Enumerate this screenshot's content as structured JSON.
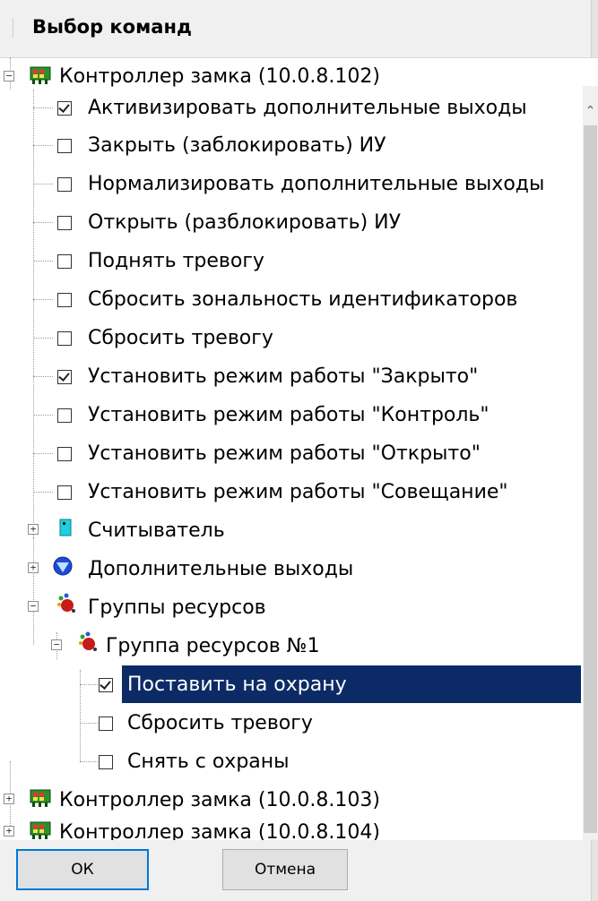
{
  "header": {
    "title": "Выбор команд"
  },
  "tree": {
    "items": [
      {
        "label": "Контроллер замка (10.0.8.102)"
      },
      {
        "label": "Активизировать дополнительные выходы",
        "checked": true
      },
      {
        "label": "Закрыть (заблокировать) ИУ",
        "checked": false
      },
      {
        "label": "Нормализировать дополнительные выходы",
        "checked": false
      },
      {
        "label": "Открыть (разблокировать) ИУ",
        "checked": false
      },
      {
        "label": "Поднять тревогу",
        "checked": false
      },
      {
        "label": "Сбросить зональность идентификаторов",
        "checked": false
      },
      {
        "label": "Сбросить тревогу",
        "checked": false
      },
      {
        "label": "Установить режим работы \"Закрыто\"",
        "checked": true
      },
      {
        "label": "Установить режим работы \"Контроль\"",
        "checked": false
      },
      {
        "label": "Установить режим работы \"Открыто\"",
        "checked": false
      },
      {
        "label": "Установить режим работы \"Совещание\"",
        "checked": false
      },
      {
        "label": "Считыватель"
      },
      {
        "label": "Дополнительные выходы"
      },
      {
        "label": "Группы ресурсов"
      },
      {
        "label": "Группа ресурсов №1"
      },
      {
        "label": "Поставить на охрану",
        "checked": true,
        "selected": true
      },
      {
        "label": "Сбросить тревогу",
        "checked": false
      },
      {
        "label": "Снять с охраны",
        "checked": false
      },
      {
        "label": "Контроллер замка (10.0.8.103)"
      },
      {
        "label": "Контроллер замка (10.0.8.104)"
      }
    ]
  },
  "buttons": {
    "ok": "ОК",
    "cancel": "Отмена"
  },
  "colors": {
    "selection": "#0c2b66",
    "ok_border": "#0078d7"
  }
}
